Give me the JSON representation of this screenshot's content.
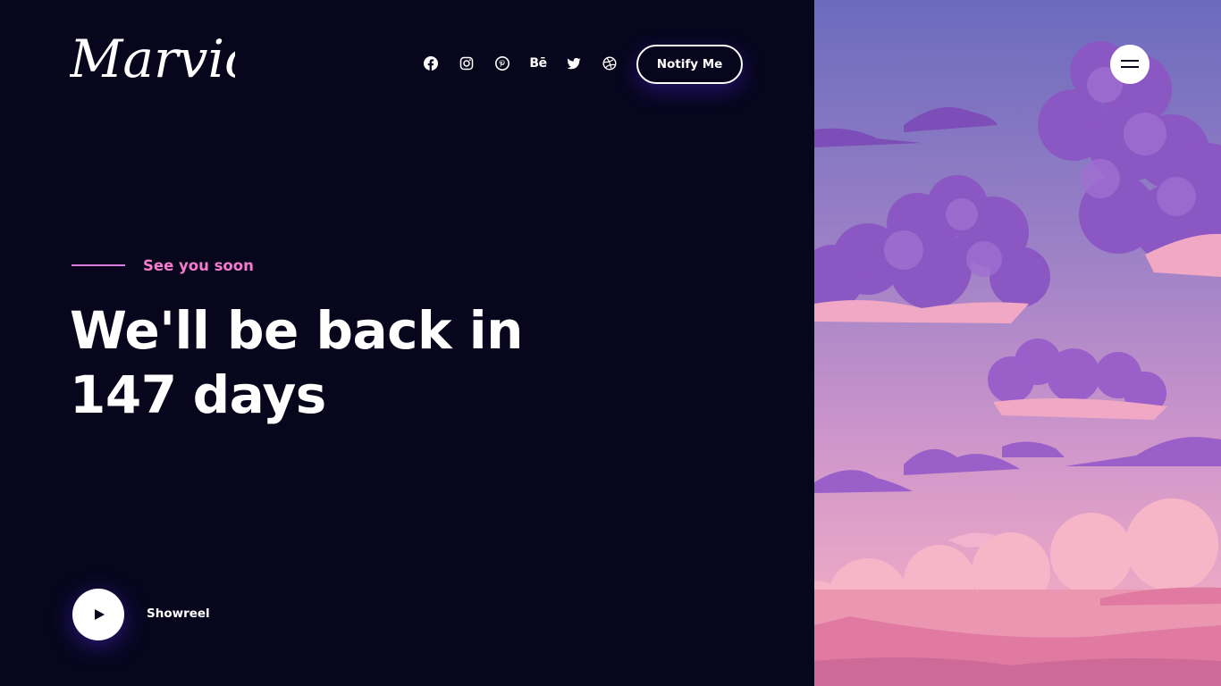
{
  "brand": {
    "logo_text": "Marvio"
  },
  "header": {
    "social_links": [
      {
        "name": "facebook",
        "icon": "facebook-icon"
      },
      {
        "name": "instagram",
        "icon": "instagram-icon"
      },
      {
        "name": "pinterest",
        "icon": "pinterest-icon"
      },
      {
        "name": "behance",
        "icon": "behance-icon",
        "label": "Bē"
      },
      {
        "name": "twitter",
        "icon": "twitter-icon"
      },
      {
        "name": "dribbble",
        "icon": "dribbble-icon"
      }
    ],
    "notify_label": "Notify Me",
    "menu_icon": "hamburger-menu-icon"
  },
  "hero": {
    "eyebrow": "See you soon",
    "headline_line1": "We'll be back in",
    "days_count": "147",
    "days_word": "days"
  },
  "showreel": {
    "label": "Showreel",
    "icon": "play-icon"
  },
  "colors": {
    "background": "#07061d",
    "accent_pink": "#f37cce",
    "accent_line": "#d97be0",
    "button_glow": "#4a1ec8"
  }
}
